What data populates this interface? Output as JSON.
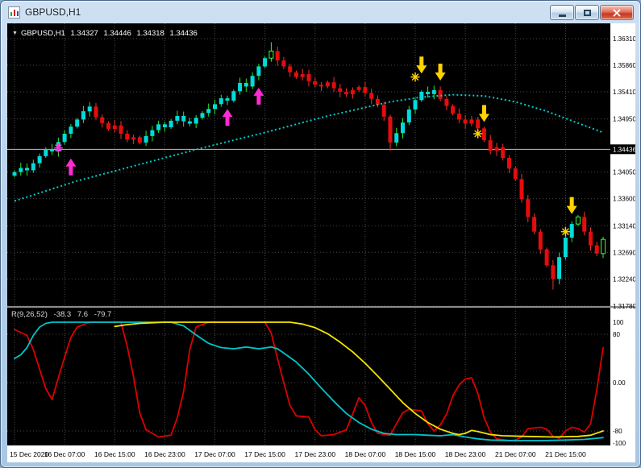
{
  "window": {
    "title": "GBPUSD,H1"
  },
  "chart": {
    "header": {
      "arrow": "▼",
      "symbol": "GBPUSD,H1",
      "open": "1.34327",
      "high": "1.34446",
      "low": "1.34318",
      "close": "1.34436"
    }
  },
  "indicator": {
    "name": "R(9,26,52)",
    "v1": "-38.3",
    "v2": "7.6",
    "v3": "-79.7"
  },
  "chart_data": {
    "type": "candlestick",
    "symbol": "GBPUSD",
    "timeframe": "H1",
    "price_axis": {
      "labels": [
        "1.36310",
        "1.35860",
        "1.35410",
        "1.34950",
        "1.34050",
        "1.33600",
        "1.33140",
        "1.32690",
        "1.32240",
        "1.31780"
      ],
      "current": "1.34436"
    },
    "time_axis": {
      "labels": [
        "15 Dec 2020",
        "16 Dec 07:00",
        "16 Dec 15:00",
        "16 Dec 23:00",
        "17 Dec 07:00",
        "17 Dec 15:00",
        "17 Dec 23:00",
        "18 Dec 07:00",
        "18 Dec 15:00",
        "18 Dec 23:00",
        "21 Dec 07:00",
        "21 Dec 15:00"
      ],
      "bars_per_label": 8
    },
    "candles": {
      "closes": [
        1.3405,
        1.3412,
        1.3408,
        1.342,
        1.3432,
        1.3444,
        1.344,
        1.3456,
        1.347,
        1.3482,
        1.3494,
        1.3508,
        1.3516,
        1.3498,
        1.3488,
        1.3478,
        1.3484,
        1.347,
        1.346,
        1.3464,
        1.3455,
        1.3466,
        1.3476,
        1.3486,
        1.3481,
        1.3492,
        1.35,
        1.3491,
        1.3487,
        1.3497,
        1.3505,
        1.3512,
        1.352,
        1.353,
        1.3526,
        1.3542,
        1.3556,
        1.355,
        1.3568,
        1.3584,
        1.3598,
        1.361,
        1.3594,
        1.3584,
        1.3574,
        1.3566,
        1.3571,
        1.3559,
        1.3553,
        1.355,
        1.3557,
        1.3547,
        1.3541,
        1.3537,
        1.3544,
        1.3549,
        1.3539,
        1.3529,
        1.3519,
        1.3499,
        1.3455,
        1.3471,
        1.3489,
        1.3511,
        1.3527,
        1.3541,
        1.3537,
        1.3544,
        1.3529,
        1.3517,
        1.3504,
        1.3494,
        1.3487,
        1.3494,
        1.3479,
        1.3459,
        1.3441,
        1.3447,
        1.3429,
        1.3411,
        1.3393,
        1.3359,
        1.3329,
        1.3304,
        1.3274,
        1.3247,
        1.3224,
        1.3261,
        1.3294,
        1.3317,
        1.3329,
        1.3304,
        1.3281,
        1.3267,
        1.3291
      ],
      "segments": [
        {
          "from": 0,
          "to": 12,
          "dir": "up"
        },
        {
          "from": 13,
          "to": 20,
          "dir": "down"
        },
        {
          "from": 21,
          "to": 41,
          "dir": "up"
        },
        {
          "from": 42,
          "to": 60,
          "dir": "down"
        },
        {
          "from": 61,
          "to": 67,
          "dir": "up"
        },
        {
          "from": 68,
          "to": 86,
          "dir": "down"
        },
        {
          "from": 87,
          "to": 90,
          "dir": "up"
        },
        {
          "from": 91,
          "to": 93,
          "dir": "down"
        },
        {
          "from": 94,
          "to": 94,
          "dir": "up"
        }
      ],
      "hollow": [
        41,
        90,
        94
      ],
      "wick_overrides": {
        "41": {
          "high": 1.3625
        },
        "60": {
          "low": 1.3441
        },
        "86": {
          "low": 1.3206
        }
      }
    },
    "ma_line": {
      "color": "#00cccc",
      "points": [
        [
          0,
          1.3356
        ],
        [
          10,
          1.339
        ],
        [
          20,
          1.3418
        ],
        [
          30,
          1.3446
        ],
        [
          40,
          1.3472
        ],
        [
          50,
          1.35
        ],
        [
          55,
          1.3512
        ],
        [
          60,
          1.3524
        ],
        [
          65,
          1.3532
        ],
        [
          70,
          1.3536
        ],
        [
          75,
          1.3534
        ],
        [
          80,
          1.3524
        ],
        [
          85,
          1.3508
        ],
        [
          90,
          1.3488
        ],
        [
          94,
          1.3472
        ]
      ]
    },
    "markers": [
      {
        "shape": "star",
        "color": "magenta",
        "bar": 7,
        "price": 1.3446
      },
      {
        "shape": "arrow-up",
        "color": "magenta",
        "bar": 9,
        "price": 1.3428
      },
      {
        "shape": "arrow-up",
        "color": "magenta",
        "bar": 34,
        "price": 1.3512
      },
      {
        "shape": "arrow-up",
        "color": "magenta",
        "bar": 39,
        "price": 1.3548
      },
      {
        "shape": "star",
        "color": "yellow",
        "bar": 64,
        "price": 1.3566
      },
      {
        "shape": "arrow-down",
        "color": "yellow",
        "bar": 65,
        "price": 1.3572
      },
      {
        "shape": "arrow-down",
        "color": "yellow",
        "bar": 68,
        "price": 1.356
      },
      {
        "shape": "star",
        "color": "yellow",
        "bar": 74,
        "price": 1.347
      },
      {
        "shape": "arrow-down",
        "color": "yellow",
        "bar": 75,
        "price": 1.349
      },
      {
        "shape": "star",
        "color": "yellow",
        "bar": 88,
        "price": 1.3304
      },
      {
        "shape": "arrow-down",
        "color": "yellow",
        "bar": 89,
        "price": 1.3334
      }
    ],
    "oscillator": {
      "label": "R(9,26,52)",
      "values": [
        -38.3,
        7.6,
        -79.7
      ],
      "scale_labels": [
        "100",
        "80",
        "0.00",
        "-80",
        "-100"
      ],
      "scale_values": [
        100,
        80,
        0,
        -80,
        -100
      ],
      "levels": [
        80,
        0,
        -80
      ],
      "range": [
        100,
        -100
      ],
      "lines": [
        {
          "name": "fast",
          "color": "#dd0000",
          "points": [
            [
              0,
              88
            ],
            [
              2,
              78
            ],
            [
              3,
              55
            ],
            [
              5,
              -10
            ],
            [
              6,
              -28
            ],
            [
              7,
              8
            ],
            [
              8,
              42
            ],
            [
              9,
              75
            ],
            [
              10,
              92
            ],
            [
              12,
              100
            ],
            [
              17,
              100
            ],
            [
              18,
              60
            ],
            [
              19,
              10
            ],
            [
              20,
              -50
            ],
            [
              21,
              -78
            ],
            [
              23,
              -90
            ],
            [
              25,
              -87
            ],
            [
              26,
              -58
            ],
            [
              27,
              -15
            ],
            [
              28,
              55
            ],
            [
              29,
              92
            ],
            [
              31,
              100
            ],
            [
              40,
              100
            ],
            [
              41,
              82
            ],
            [
              42,
              40
            ],
            [
              43,
              0
            ],
            [
              44,
              -38
            ],
            [
              45,
              -55
            ],
            [
              47,
              -57
            ],
            [
              48,
              -78
            ],
            [
              49,
              -88
            ],
            [
              51,
              -86
            ],
            [
              53,
              -78
            ],
            [
              54,
              -52
            ],
            [
              55,
              -25
            ],
            [
              56,
              -38
            ],
            [
              57,
              -66
            ],
            [
              58,
              -84
            ],
            [
              60,
              -87
            ],
            [
              61,
              -68
            ],
            [
              62,
              -50
            ],
            [
              63,
              -44
            ],
            [
              65,
              -47
            ],
            [
              66,
              -68
            ],
            [
              67,
              -80
            ],
            [
              68,
              -70
            ],
            [
              69,
              -52
            ],
            [
              70,
              -22
            ],
            [
              71,
              -4
            ],
            [
              72,
              6
            ],
            [
              73,
              8
            ],
            [
              74,
              -18
            ],
            [
              75,
              -58
            ],
            [
              76,
              -82
            ],
            [
              77,
              -93
            ],
            [
              79,
              -96
            ],
            [
              80,
              -95
            ],
            [
              81,
              -90
            ],
            [
              82,
              -76
            ],
            [
              84,
              -74
            ],
            [
              85,
              -77
            ],
            [
              86,
              -89
            ],
            [
              87,
              -92
            ],
            [
              88,
              -80
            ],
            [
              89,
              -74
            ],
            [
              90,
              -76
            ],
            [
              91,
              -82
            ],
            [
              92,
              -68
            ],
            [
              93,
              -12
            ],
            [
              94,
              58
            ]
          ]
        },
        {
          "name": "mid",
          "color": "#00c4cc",
          "points": [
            [
              0,
              40
            ],
            [
              1,
              46
            ],
            [
              2,
              58
            ],
            [
              3,
              78
            ],
            [
              4,
              92
            ],
            [
              5,
              98
            ],
            [
              6,
              100
            ],
            [
              25,
              100
            ],
            [
              27,
              94
            ],
            [
              29,
              79
            ],
            [
              31,
              65
            ],
            [
              33,
              58
            ],
            [
              35,
              56
            ],
            [
              37,
              59
            ],
            [
              39,
              56
            ],
            [
              41,
              59
            ],
            [
              42,
              56
            ],
            [
              43,
              49
            ],
            [
              45,
              34
            ],
            [
              47,
              14
            ],
            [
              49,
              -9
            ],
            [
              51,
              -31
            ],
            [
              53,
              -51
            ],
            [
              55,
              -66
            ],
            [
              57,
              -77
            ],
            [
              59,
              -84
            ],
            [
              61,
              -86
            ],
            [
              64,
              -86
            ],
            [
              66,
              -87
            ],
            [
              68,
              -88
            ],
            [
              70,
              -86
            ],
            [
              72,
              -90
            ],
            [
              74,
              -93
            ],
            [
              76,
              -95
            ],
            [
              80,
              -96
            ],
            [
              84,
              -96
            ],
            [
              88,
              -95
            ],
            [
              91,
              -94
            ],
            [
              94,
              -91
            ]
          ]
        },
        {
          "name": "slow",
          "color": "#f2e400",
          "points": [
            [
              16,
              93
            ],
            [
              18,
              96
            ],
            [
              20,
              98
            ],
            [
              24,
              100
            ],
            [
              44,
              100
            ],
            [
              46,
              97
            ],
            [
              48,
              91
            ],
            [
              50,
              81
            ],
            [
              52,
              67
            ],
            [
              54,
              51
            ],
            [
              56,
              32
            ],
            [
              58,
              11
            ],
            [
              60,
              -11
            ],
            [
              62,
              -33
            ],
            [
              64,
              -51
            ],
            [
              66,
              -66
            ],
            [
              68,
              -77
            ],
            [
              70,
              -84
            ],
            [
              71,
              -86
            ],
            [
              72,
              -84
            ],
            [
              73,
              -79
            ],
            [
              74,
              -81
            ],
            [
              76,
              -86
            ],
            [
              78,
              -88
            ],
            [
              82,
              -89
            ],
            [
              86,
              -90
            ],
            [
              90,
              -89
            ],
            [
              92,
              -87
            ],
            [
              94,
              -80
            ]
          ]
        }
      ]
    },
    "colors": {
      "bull_body": "#00dcdc",
      "bull_wick": "#28e828",
      "bear_body": "#e60c0c",
      "bear_wick": "#f23030",
      "hollow": "#2eff2e",
      "bid_line": "#c0c0c0",
      "grid": "#4a4a4a",
      "marker_up": "#ff2ad2",
      "marker_down": "#ffd300"
    }
  }
}
